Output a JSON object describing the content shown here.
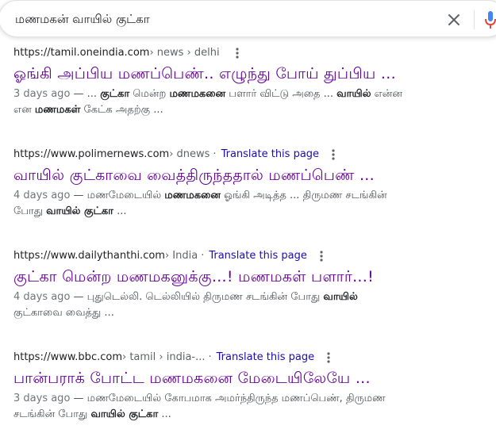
{
  "search": {
    "query": "மணமகன் வாயில் குட்கா"
  },
  "colors": {
    "visited_link": "#660099",
    "link": "#1a0dab",
    "mic_blue": "#4285f4",
    "mic_red": "#ea4335"
  },
  "results": [
    {
      "url": "https://tamil.oneindia.com",
      "path": " › news › delhi",
      "translate": "",
      "title": "ஓங்கி அப்பிய மணப்பெண்.. எழுந்து போய் துப்பிய ...",
      "date": "3 days ago",
      "line1": [
        {
          "t": " — ... ",
          "b": false
        },
        {
          "t": "குட்கா",
          "b": true
        },
        {
          "t": " மென்ற ",
          "b": false
        },
        {
          "t": "மணமகனை",
          "b": true
        },
        {
          "t": " பளார் விட்டு அதை ... ",
          "b": false
        },
        {
          "t": "வாயில்",
          "b": true
        },
        {
          "t": " என்ன",
          "b": false
        }
      ],
      "line2": [
        {
          "t": "என ",
          "b": false
        },
        {
          "t": "மணமகள்",
          "b": true
        },
        {
          "t": " கேட்க அதற்கு ...",
          "b": false
        }
      ]
    },
    {
      "url": "https://www.polimernews.com",
      "path": " › dnews",
      "translate": "Translate this page",
      "title": "வாயில் குட்காவை வைத்திருந்ததால் மணப்பெண் ...",
      "date": "4 days ago",
      "line1": [
        {
          "t": " — மணமேடையில் ",
          "b": false
        },
        {
          "t": "மணமகனை",
          "b": true
        },
        {
          "t": " ஓங்கி அடித்த ... திருமண சடங்கின்",
          "b": false
        }
      ],
      "line2": [
        {
          "t": "போது ",
          "b": false
        },
        {
          "t": "வாயில் குட்கா",
          "b": true
        },
        {
          "t": " ...",
          "b": false
        }
      ]
    },
    {
      "url": "https://www.dailythanthi.com",
      "path": " › India",
      "translate": "Translate this page",
      "title": "குட்கா மென்ற மணமகனுக்கு...! மணமகள் பளார்...!",
      "date": "4 days ago",
      "line1": [
        {
          "t": " — புதுடெல்லி. டெல்லியில் திருமண சடங்கின் போது ",
          "b": false
        },
        {
          "t": "வாயில்",
          "b": true
        }
      ],
      "line2": [
        {
          "t": "குட்காவை வைத்து ...",
          "b": false
        }
      ]
    },
    {
      "url": "https://www.bbc.com",
      "path": " › tamil › india-...",
      "translate": "Translate this page",
      "title": "பான்பராக் போட்ட மணமகனை மேடையிலேயே ...",
      "date": "3 days ago",
      "line1": [
        {
          "t": " — மணமேடையில் கோபமாக அமர்ந்திருந்த மணப்பெண், திருமண",
          "b": false
        }
      ],
      "line2": [
        {
          "t": "சடங்கின் போது ",
          "b": false
        },
        {
          "t": "வாயில் குட்கா",
          "b": true
        },
        {
          "t": " ...",
          "b": false
        }
      ]
    }
  ]
}
